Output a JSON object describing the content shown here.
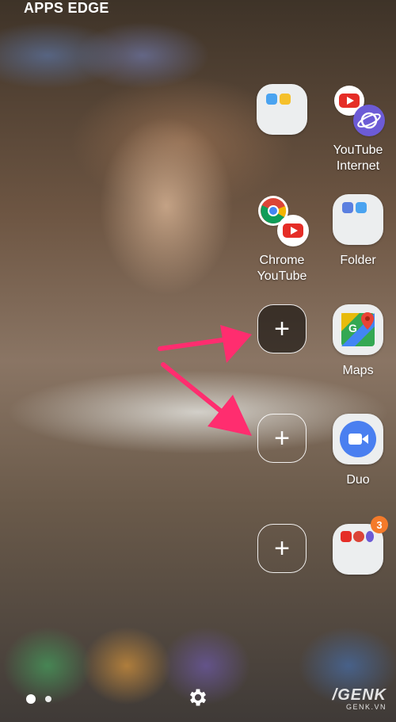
{
  "panel": {
    "title": "APPS EDGE"
  },
  "apps": {
    "folder_top": {
      "label": ""
    },
    "youtube_internet": {
      "label": "YouTube\nInternet"
    },
    "chrome_youtube": {
      "label": "Chrome\nYouTube"
    },
    "folder": {
      "label": "Folder"
    },
    "maps": {
      "label": "Maps"
    },
    "duo": {
      "label": "Duo"
    },
    "folder_bottom": {
      "badge": "3"
    }
  },
  "add_slots": {
    "symbol": "+"
  },
  "footer": {
    "watermark_brand": "/GENK",
    "watermark_site": "GENK.VN"
  },
  "colors": {
    "arrow": "#ff2d6f",
    "badge": "#f47a2a",
    "accent_blue": "#4a7ff0"
  }
}
